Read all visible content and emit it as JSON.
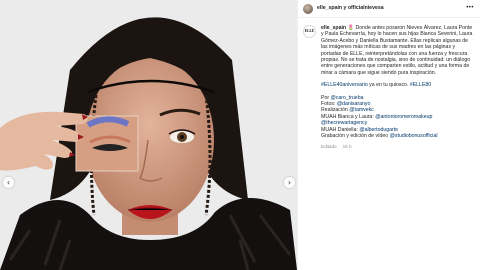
{
  "post": {
    "header_text": "elle_spain y officialnievesa",
    "more_icon": "more-options-icon",
    "username": "elle_spain",
    "caption_text": "🌷 Donde antes posaron Nieves Álvarez, Laura Ponte y Paula Echevarría, hoy lo hacen sus hijas Bianca Severini, Laura Gómez-Acebo y Daniella Bustamante. Ellas replican algunas de las imágenes más míticas de sus madres en las páginas y portadas de ELLE, reinterpretándolas con una fuerza y frescura propias. No se trata de nostalgia, sino de continuidad: un diálogo entre generaciones que comparten estilo, actitud y una forma de mirar a cámara que sigue siendo pura inspiración.",
    "hashtags": "#ELLE40aniversario",
    "hashtags_tail": " ya en tu quiosco. ",
    "hashtag2": "#ELLE80",
    "credits": {
      "por_label": "Por ",
      "por_mention": "@caro_trueba",
      "fotos_label": "Fotos: ",
      "fotos_mention": "@danisaranyo",
      "realizacion_label": "Realización ",
      "realizacion_mention": "@tamvekc",
      "mua1_label": "MUAH Bianca y Laura: ",
      "mua1_mention": "@antonioromeromakeup",
      "agency_mention": "@thecrewartagency",
      "mua2_label": "MUAH Daniella: ",
      "mua2_mention": "@albertodugarte",
      "video_label": "Grabación y edición de vídeo ",
      "video_mention": "@studiobonusofficial"
    },
    "edited": "Editado",
    "ago": "16 h"
  },
  "photo": {
    "prev_icon": "chevron-left-icon",
    "next_icon": "chevron-right-icon",
    "prev_glyph": "‹",
    "next_glyph": "›",
    "background_color": "#e9e9e9",
    "lip_color": "#b8141c",
    "hair_color": "#1b1410"
  }
}
